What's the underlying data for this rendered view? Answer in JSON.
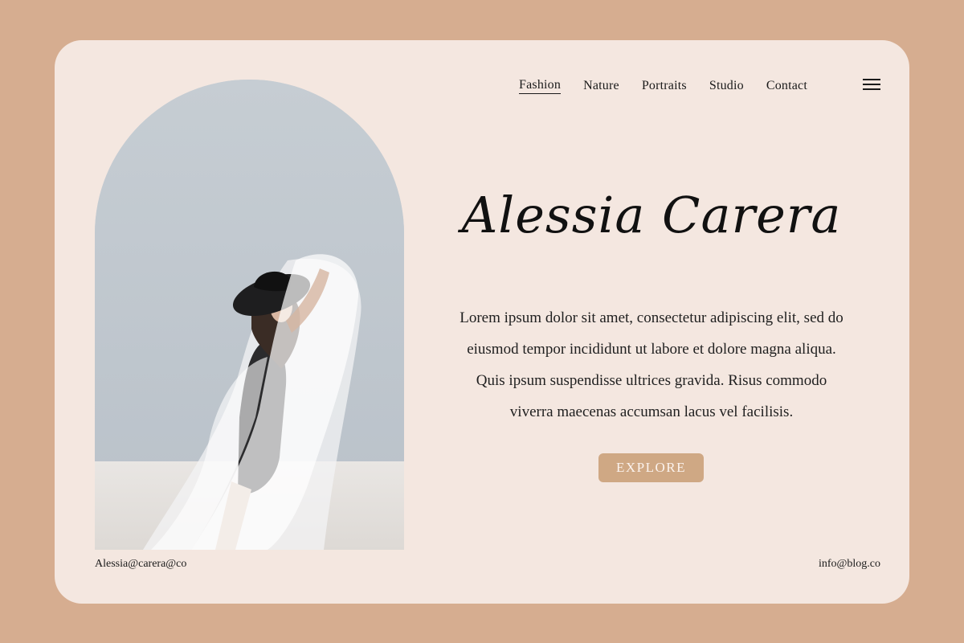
{
  "nav": {
    "items": [
      {
        "label": "Fashion",
        "active": true
      },
      {
        "label": "Nature",
        "active": false
      },
      {
        "label": "Portraits",
        "active": false
      },
      {
        "label": "Studio",
        "active": false
      },
      {
        "label": "Contact",
        "active": false
      }
    ],
    "menu_icon": "hamburger-menu-icon"
  },
  "hero": {
    "title": "Alessia Carera",
    "description": "Lorem ipsum dolor sit amet, consectetur adipiscing elit, sed do eiusmod tempor incididunt ut labore et dolore magna aliqua. Quis ipsum suspendisse ultrices gravida. Risus commodo viverra maecenas accumsan lacus vel facilisis.",
    "button_label": "EXPLORE"
  },
  "footer": {
    "left_email": "Alessia@carera@co",
    "right_email": "info@blog.co"
  },
  "colors": {
    "background": "#D6AD90",
    "card": "#F4E7E0",
    "accent": "#CFA884",
    "text": "#1a1a1a"
  }
}
